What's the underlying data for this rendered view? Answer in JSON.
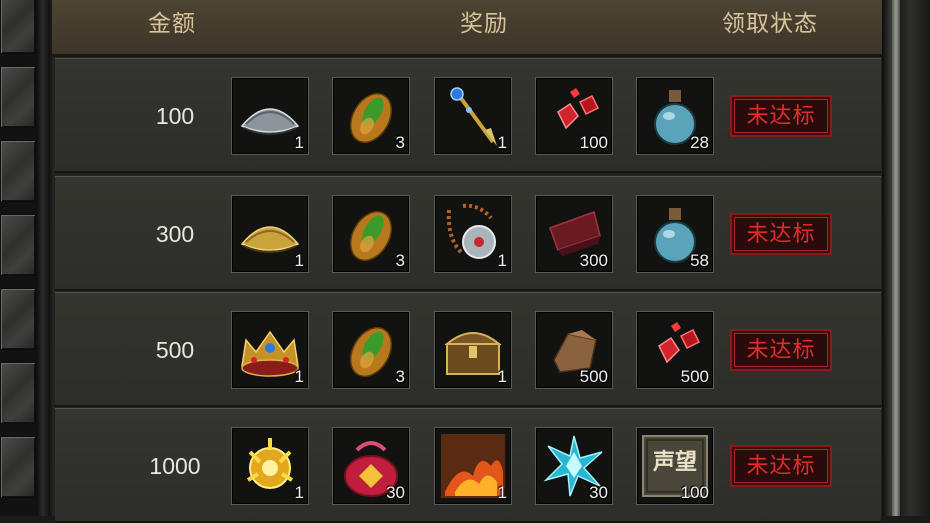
{
  "header": {
    "amount_label": "金额",
    "reward_label": "奖励",
    "status_label": "领取状态"
  },
  "rows": [
    {
      "amount": "100",
      "status": "未达标",
      "items": [
        {
          "icon": "iron-hat-icon",
          "qty": "1"
        },
        {
          "icon": "green-jade-seed-icon",
          "qty": "3"
        },
        {
          "icon": "blue-dagger-icon",
          "qty": "1"
        },
        {
          "icon": "red-gems-icon",
          "qty": "100"
        },
        {
          "icon": "blue-potion-icon",
          "qty": "28"
        }
      ]
    },
    {
      "amount": "300",
      "status": "未达标",
      "items": [
        {
          "icon": "golden-hat-icon",
          "qty": "1"
        },
        {
          "icon": "green-jade-seed-icon",
          "qty": "3"
        },
        {
          "icon": "bead-necklace-icon",
          "qty": "1"
        },
        {
          "icon": "red-scroll-icon",
          "qty": "300"
        },
        {
          "icon": "blue-potion-icon",
          "qty": "58"
        }
      ]
    },
    {
      "amount": "500",
      "status": "未达标",
      "items": [
        {
          "icon": "jeweled-crown-icon",
          "qty": "1"
        },
        {
          "icon": "green-jade-seed-icon",
          "qty": "3"
        },
        {
          "icon": "treasure-chest-icon",
          "qty": "1"
        },
        {
          "icon": "leather-scrap-icon",
          "qty": "500"
        },
        {
          "icon": "red-gems-icon",
          "qty": "500"
        }
      ]
    },
    {
      "amount": "1000",
      "status": "未达标",
      "items": [
        {
          "icon": "golden-emblem-icon",
          "qty": "1"
        },
        {
          "icon": "lucky-bag-icon",
          "qty": "30"
        },
        {
          "icon": "flame-scroll-icon",
          "qty": "1"
        },
        {
          "icon": "cyan-crystal-icon",
          "qty": "30"
        },
        {
          "icon": "reputation-tablet-icon",
          "qty": "100",
          "tablet_text": "声望"
        }
      ]
    }
  ]
}
